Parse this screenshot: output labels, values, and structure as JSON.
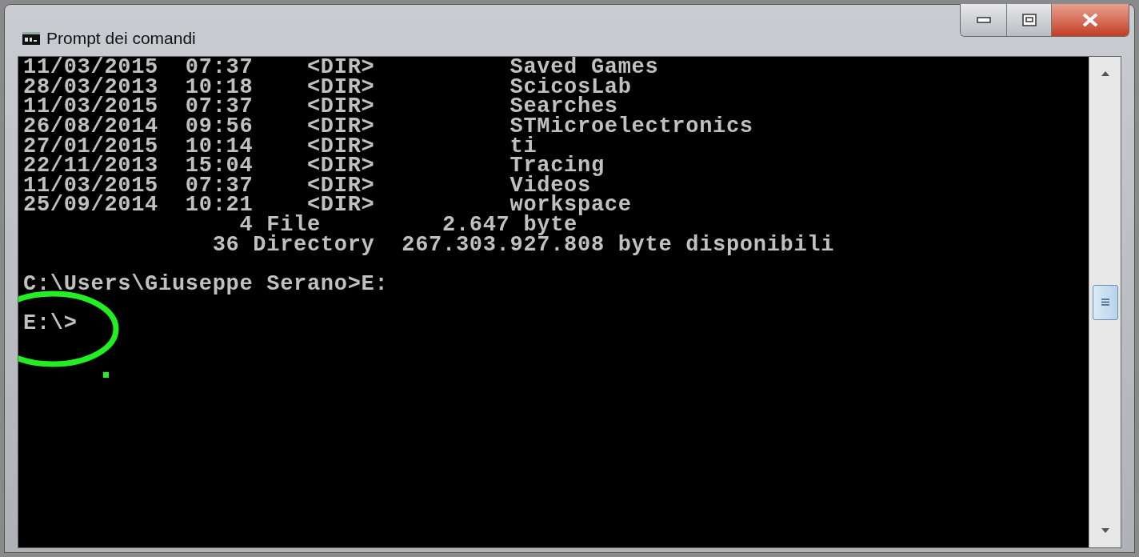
{
  "window": {
    "title": "Prompt dei comandi"
  },
  "console": {
    "lines": [
      {
        "kind": "text",
        "text": "11/03/2015  07:37    <DIR>          Saved Games"
      },
      {
        "kind": "text",
        "text": "28/03/2013  10:18    <DIR>          ScicosLab"
      },
      {
        "kind": "text",
        "text": "11/03/2015  07:37    <DIR>          Searches"
      },
      {
        "kind": "text",
        "text": "26/08/2014  09:56    <DIR>          STMicroelectronics"
      },
      {
        "kind": "text",
        "text": "27/01/2015  10:14    <DIR>          ti"
      },
      {
        "kind": "text",
        "text": "22/11/2013  15:04    <DIR>          Tracing"
      },
      {
        "kind": "text",
        "text": "11/03/2015  07:37    <DIR>          Videos"
      },
      {
        "kind": "text",
        "text": "25/09/2014  10:21    <DIR>          workspace"
      },
      {
        "kind": "text",
        "text": "                4 File         2.647 byte"
      },
      {
        "kind": "text",
        "text": "              36 Directory  267.303.927.808 byte disponibili"
      },
      {
        "kind": "blank"
      },
      {
        "kind": "text",
        "text": "C:\\Users\\Giuseppe Serano>E:"
      },
      {
        "kind": "blank"
      },
      {
        "kind": "text",
        "text": "E:\\>"
      }
    ]
  }
}
